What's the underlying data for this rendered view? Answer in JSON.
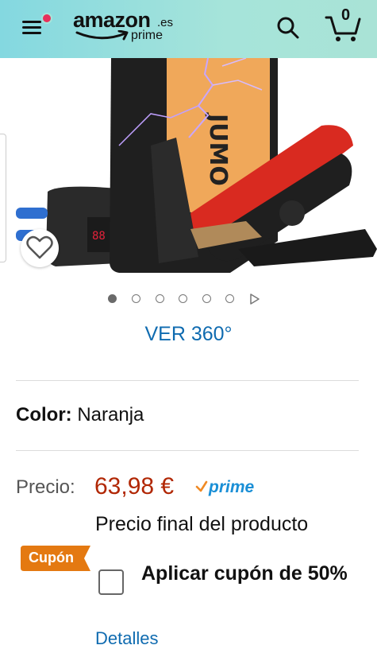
{
  "header": {
    "logo_main": "amazon",
    "logo_tld": ".es",
    "logo_sub": "prime",
    "cart_count": "0",
    "icons": [
      "menu-icon",
      "search-icon",
      "cart-icon"
    ]
  },
  "gallery": {
    "total_dots": 6,
    "active_index": 0,
    "has_video": true
  },
  "view360": "VER 360°",
  "color": {
    "label": "Color:",
    "value": "Naranja"
  },
  "price": {
    "label": "Precio:",
    "value": "63,98 €",
    "prime": "prime",
    "note": "Precio final del producto"
  },
  "coupon": {
    "badge": "Cupón",
    "apply": "Aplicar cupón de 50%",
    "checked": false
  },
  "link_partial": "Detalles",
  "colors": {
    "header_start": "#84d8e0",
    "header_end": "#a9e3d6",
    "price": "#b12704",
    "link": "#0f6bb0",
    "badge": "#e47911",
    "prime": "#1a8fd6"
  }
}
